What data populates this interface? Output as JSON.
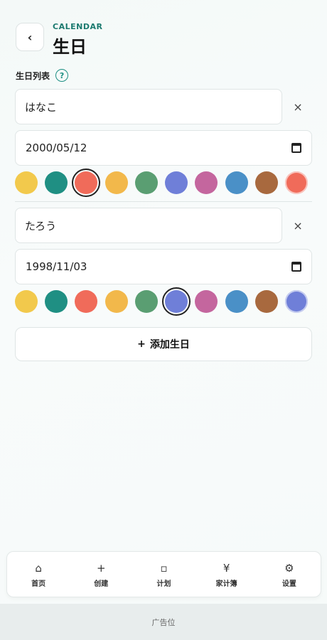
{
  "header": {
    "back_icon": "chevron-left-icon",
    "back_glyph": "‹",
    "kicker": "CALENDAR",
    "title": "生日"
  },
  "section": {
    "label": "生日列表",
    "help_glyph": "?"
  },
  "palette": [
    "#f2c94c",
    "#1f8f83",
    "#f06b5a",
    "#f2b84b",
    "#5a9e72",
    "#6f7fd8",
    "#c4669e",
    "#4a90c7",
    "#a8693e"
  ],
  "entries": [
    {
      "name": "はなこ",
      "date": "2000/05/12",
      "selected_index": 2,
      "custom_color": "#f06b5a",
      "remove_glyph": "×"
    },
    {
      "name": "たろう",
      "date": "1998/11/03",
      "selected_index": 5,
      "custom_color": "#6f7fd8",
      "remove_glyph": "×"
    }
  ],
  "add_button": {
    "plus": "+",
    "label": "添加生日"
  },
  "nav": [
    {
      "icon": "home-icon",
      "glyph": "⌂",
      "label": "首页"
    },
    {
      "icon": "plus-icon",
      "glyph": "+",
      "label": "创建"
    },
    {
      "icon": "square-icon",
      "glyph": "▫",
      "label": "计划"
    },
    {
      "icon": "yen-icon",
      "glyph": "¥",
      "label": "家计簿"
    },
    {
      "icon": "gear-icon",
      "glyph": "⚙",
      "label": "设置"
    }
  ],
  "ad": {
    "label": "广告位"
  }
}
